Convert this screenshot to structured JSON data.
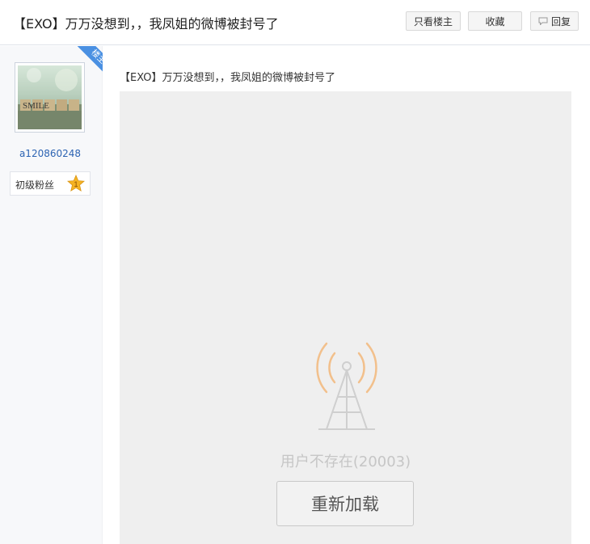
{
  "header": {
    "title": "【EXO】万万没想到，，我凤姐的微博被封号了",
    "only_host_label": "只看楼主",
    "favorite_label": "收藏",
    "reply_label": "回复"
  },
  "sidebar": {
    "badge": "楼主",
    "avatar_text": "SMILE",
    "username": "a120860248",
    "level_label": "初级粉丝",
    "level_number": "1"
  },
  "post": {
    "title": "【EXO】万万没想到，，我凤姐的微博被封号了",
    "error_text": "用户不存在(20003)",
    "reload_label": "重新加载"
  },
  "colors": {
    "accent_blue": "#4a90e2",
    "link_blue": "#2d64b3",
    "star_gold": "#f5b324",
    "signal_orange": "#f2c08c"
  }
}
